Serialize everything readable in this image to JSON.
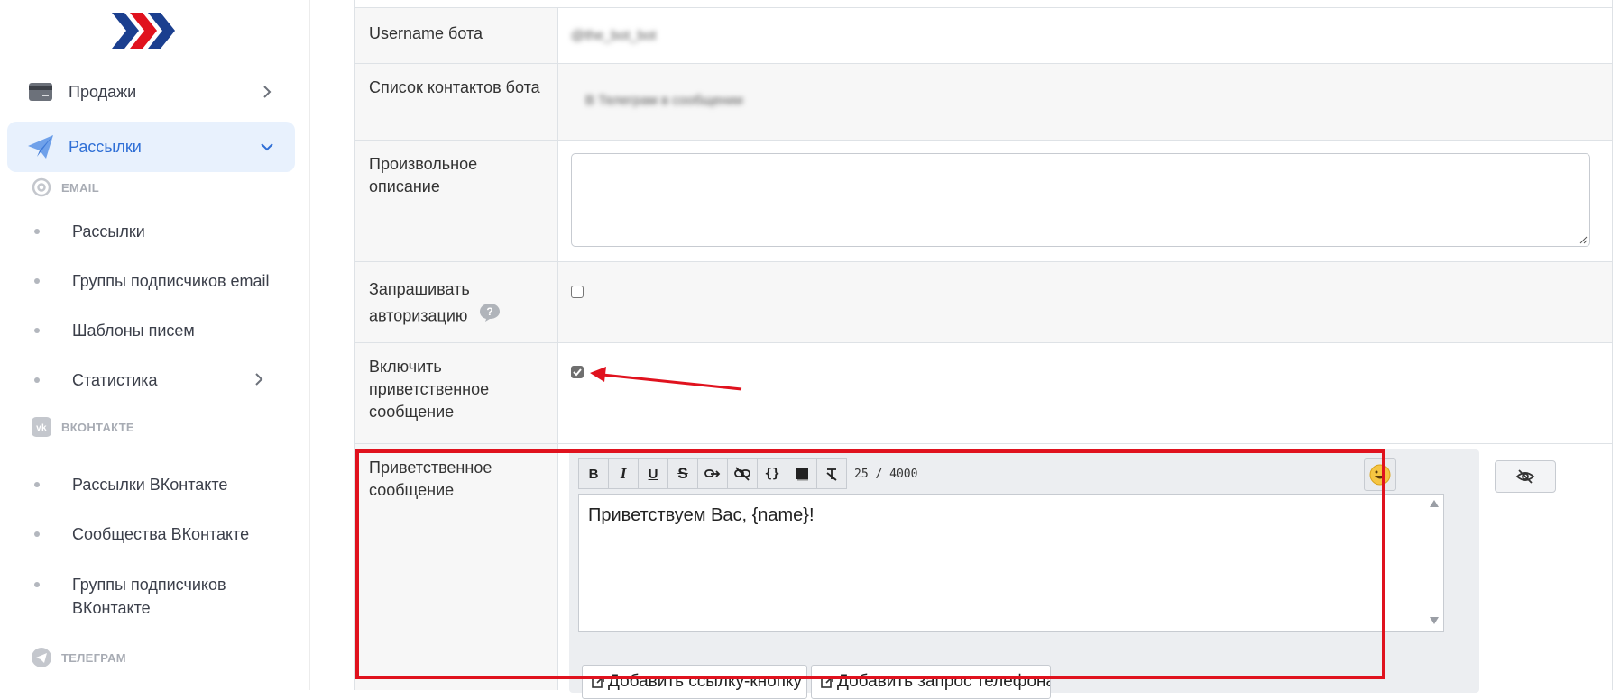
{
  "sidebar": {
    "sales": {
      "label": "Продажи",
      "icon": "credit-card-icon"
    },
    "mailings": {
      "label": "Рассылки",
      "icon": "paper-plane-icon"
    },
    "sections": {
      "email": {
        "label": "EMAIL",
        "icon": "at-sign-icon"
      },
      "vk": {
        "label": "ВКОНТАКТЕ",
        "icon": "vk-icon"
      },
      "telegram": {
        "label": "ТЕЛЕГРАМ",
        "icon": "telegram-icon"
      }
    },
    "email_items": [
      "Рассылки",
      "Группы подписчиков email",
      "Шаблоны писем",
      "Статистика"
    ],
    "vk_items": [
      "Рассылки ВКонтакте",
      "Сообщества ВКонтакте",
      "Группы подписчиков ВКонтакте"
    ]
  },
  "form": {
    "username": {
      "label": "Username бота",
      "value": "@the_bot_bot"
    },
    "contacts": {
      "label": "Список контактов бота",
      "value": "В Телеграм в сообщении"
    },
    "description": {
      "label": "Произвольное описание",
      "value": ""
    },
    "auth": {
      "label": "Запрашивать авторизацию",
      "checked": false
    },
    "welcome_toggle": {
      "label": "Включить приветственное сообщение",
      "checked": true
    },
    "welcome_message": {
      "label": "Приветственное сообщение",
      "text": "Приветствуем Вас, {name}!",
      "counter": "25 / 4000",
      "toolbar": [
        "bold",
        "italic",
        "underline",
        "strikethrough",
        "link",
        "unlink",
        "code",
        "spoiler",
        "clear-format"
      ],
      "buttons": {
        "add_link": "Добавить ссылку-кнопку",
        "add_phone": "Добавить запрос телефона"
      }
    }
  },
  "colors": {
    "accent": "#2f6fd6",
    "active_bg": "#e8f1fd",
    "annotation": "#e0121e",
    "logo_blue": "#1b3f8f",
    "logo_red": "#e0121e"
  }
}
